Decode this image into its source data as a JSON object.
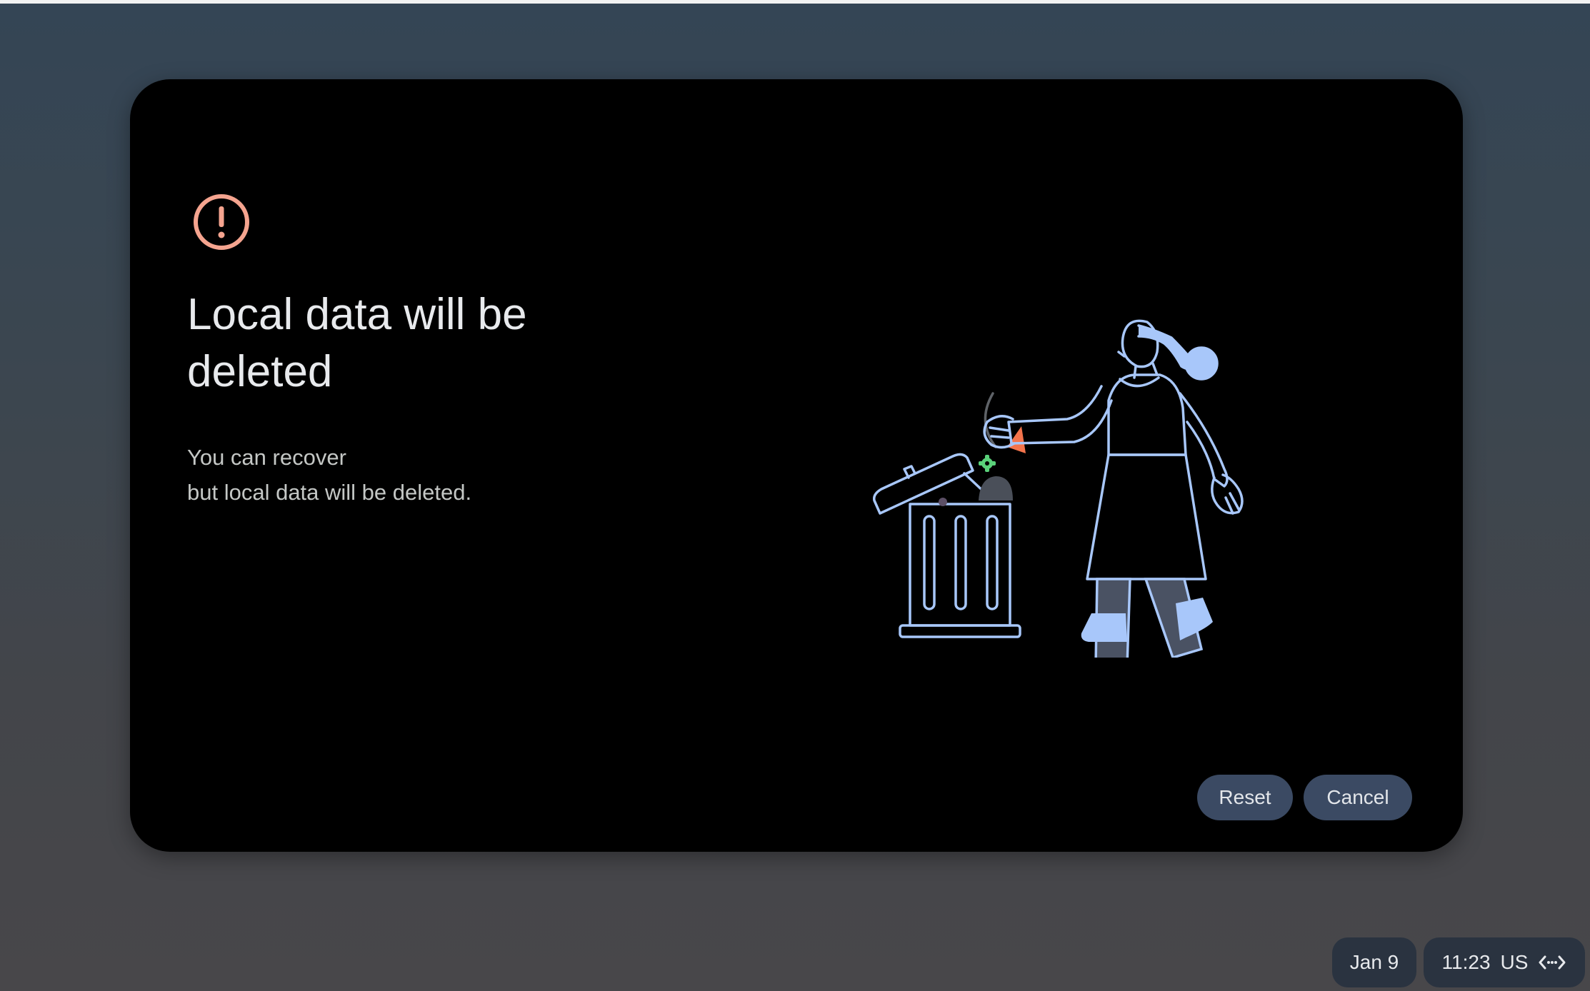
{
  "dialog": {
    "title": "Local data will be deleted",
    "body_line1": "You can recover",
    "body_line2": "but local data will be deleted.",
    "icon": "alert-circle-icon",
    "buttons": {
      "reset_label": "Reset",
      "cancel_label": "Cancel"
    },
    "illustration": "person-throwing-trash-illustration"
  },
  "shelf": {
    "date": "Jan 9",
    "time": "11:23",
    "input_method": "US",
    "network_icon": "network-arrows-icon"
  },
  "colors": {
    "accent_alert": "#f5a48f",
    "illustration_line": "#a8c7fa",
    "button_bg": "#3b4a63",
    "dialog_bg": "#000000"
  }
}
